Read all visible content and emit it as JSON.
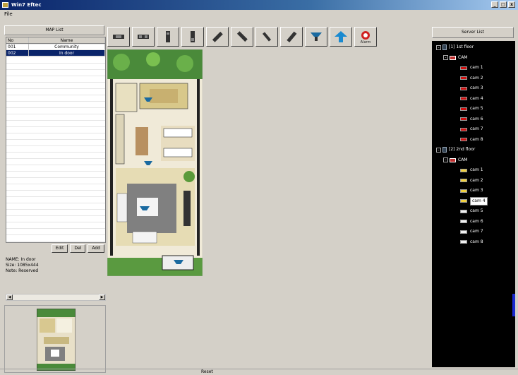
{
  "window": {
    "title": "Win7 Eftec",
    "min": "_",
    "max": "□",
    "close": "x"
  },
  "menu": {
    "file": "File"
  },
  "map_list": {
    "header": "MAP List",
    "columns": {
      "no": "No",
      "name": "Name"
    },
    "rows": [
      {
        "no": "001",
        "name": "Community"
      },
      {
        "no": "002",
        "name": "In door"
      }
    ],
    "selected_index": 1,
    "buttons": {
      "edit": "Edit",
      "del": "Del",
      "add": "Add"
    }
  },
  "info": {
    "name": "NAME: In door",
    "size": "Size: 1085x444",
    "note": "Note: Reserved"
  },
  "toolbar": {
    "icons": [
      "ptz-cam-icon",
      "dome-cam-icon",
      "box-cam-icon",
      "bullet-cam-icon",
      "sensor-left-icon",
      "sensor-right-icon",
      "sensor-diag-icon",
      "sensor-up-icon",
      "speed-dome-icon",
      "network-cam-icon",
      "alarm-icon"
    ],
    "alarm_label": "Alarm"
  },
  "server_list": {
    "header": "Server List",
    "servers": [
      {
        "label": "[1] 1st floor",
        "group": "CAM",
        "color": "red",
        "cams": [
          "cam 1",
          "cam 2",
          "cam 3",
          "cam 4",
          "cam 5",
          "cam 6",
          "cam 7",
          "cam 8"
        ]
      },
      {
        "label": "[2] 2nd floor",
        "group": "CAM",
        "color": "yellow",
        "cams": [
          "cam 1",
          "cam 2",
          "cam 3",
          "cam 4",
          "cam 5",
          "cam 6",
          "cam 7",
          "cam 8"
        ],
        "selected": "cam 4"
      }
    ]
  },
  "status": {
    "text": "Reset"
  },
  "colors": {
    "title_start": "#0a246a",
    "tree_bg": "#000000",
    "selection": "#0a246a"
  }
}
